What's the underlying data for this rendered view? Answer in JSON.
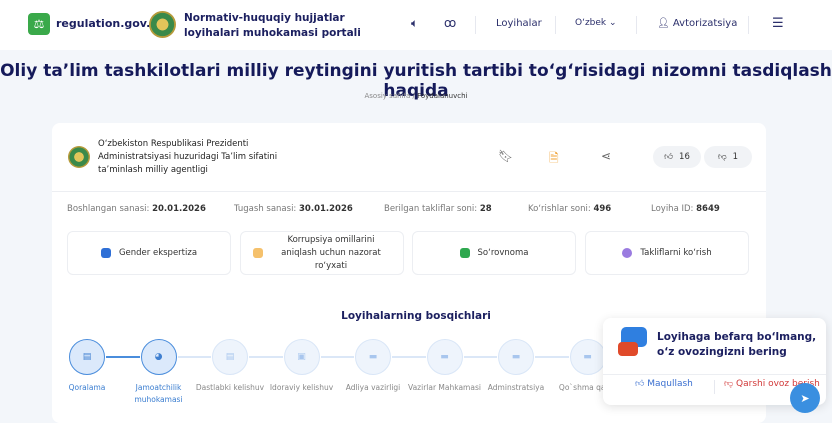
{
  "header": {
    "site": "regulation.gov.uz",
    "portal_line1": "Normativ-huquqiy hujjatlar",
    "portal_line2": "loyihalari muhokamasi portali",
    "projects": "Loyihalar",
    "language": "O‘zbek",
    "login": "Avtorizatsiya"
  },
  "page": {
    "title": "Oliy ta’lim tashkilotlari milliy reytingini yuritish tartibi to‘g‘risidagi nizomni tasdiqlash haqida",
    "breadcrumb": [
      "Asosiy sahifa",
      "Foydalanuvchi"
    ]
  },
  "org": {
    "line1": "O‘zbekiston Respublikasi Prezidenti",
    "line2": "Administratsiyasi huzuridagi Ta’lim sifatini",
    "line3": "ta’minlash milliy agentligi",
    "likes": "16",
    "dislikes": "1"
  },
  "stats": [
    {
      "label": "Boshlangan sanasi:",
      "value": "20.01.2026"
    },
    {
      "label": "Tugash sanasi:",
      "value": "30.01.2026"
    },
    {
      "label": "Berilgan takliflar soni:",
      "value": "28"
    },
    {
      "label": "Ko‘rishlar soni:",
      "value": "496"
    },
    {
      "label": "Loyiha ID:",
      "value": "8649"
    }
  ],
  "actions": [
    {
      "label": "Gender ekspertiza",
      "color": "#2f6fd6"
    },
    {
      "label": "Korrupsiya omillarini aniqlash uchun nazorat ro‘yxati",
      "color": "#f5c16c"
    },
    {
      "label": "So‘rovnoma",
      "color": "#2fa84f"
    },
    {
      "label": "Takliflarni ko‘rish",
      "color": "#9a7be0"
    }
  ],
  "stages": {
    "title": "Loyihalarning bosqichlari",
    "items": [
      {
        "label": "Qoralama",
        "active": true
      },
      {
        "label": "Jamoatchilik muhokamasi",
        "active": true
      },
      {
        "label": "Dastlabki kelishuv",
        "active": false
      },
      {
        "label": "Idoraviy kelishuv",
        "active": false
      },
      {
        "label": "Adliya vazirligi",
        "active": false
      },
      {
        "label": "Vazirlar Mahkamasi",
        "active": false
      },
      {
        "label": "Adminstratsiya",
        "active": false
      },
      {
        "label": "Qo`shma qaror",
        "active": false
      }
    ]
  },
  "popup": {
    "line1": "Loyihaga befarq bo‘lmang,",
    "line2": "o‘z ovozingizni bering",
    "approve": "Maqullash",
    "against": "Qarshi ovoz berish"
  }
}
